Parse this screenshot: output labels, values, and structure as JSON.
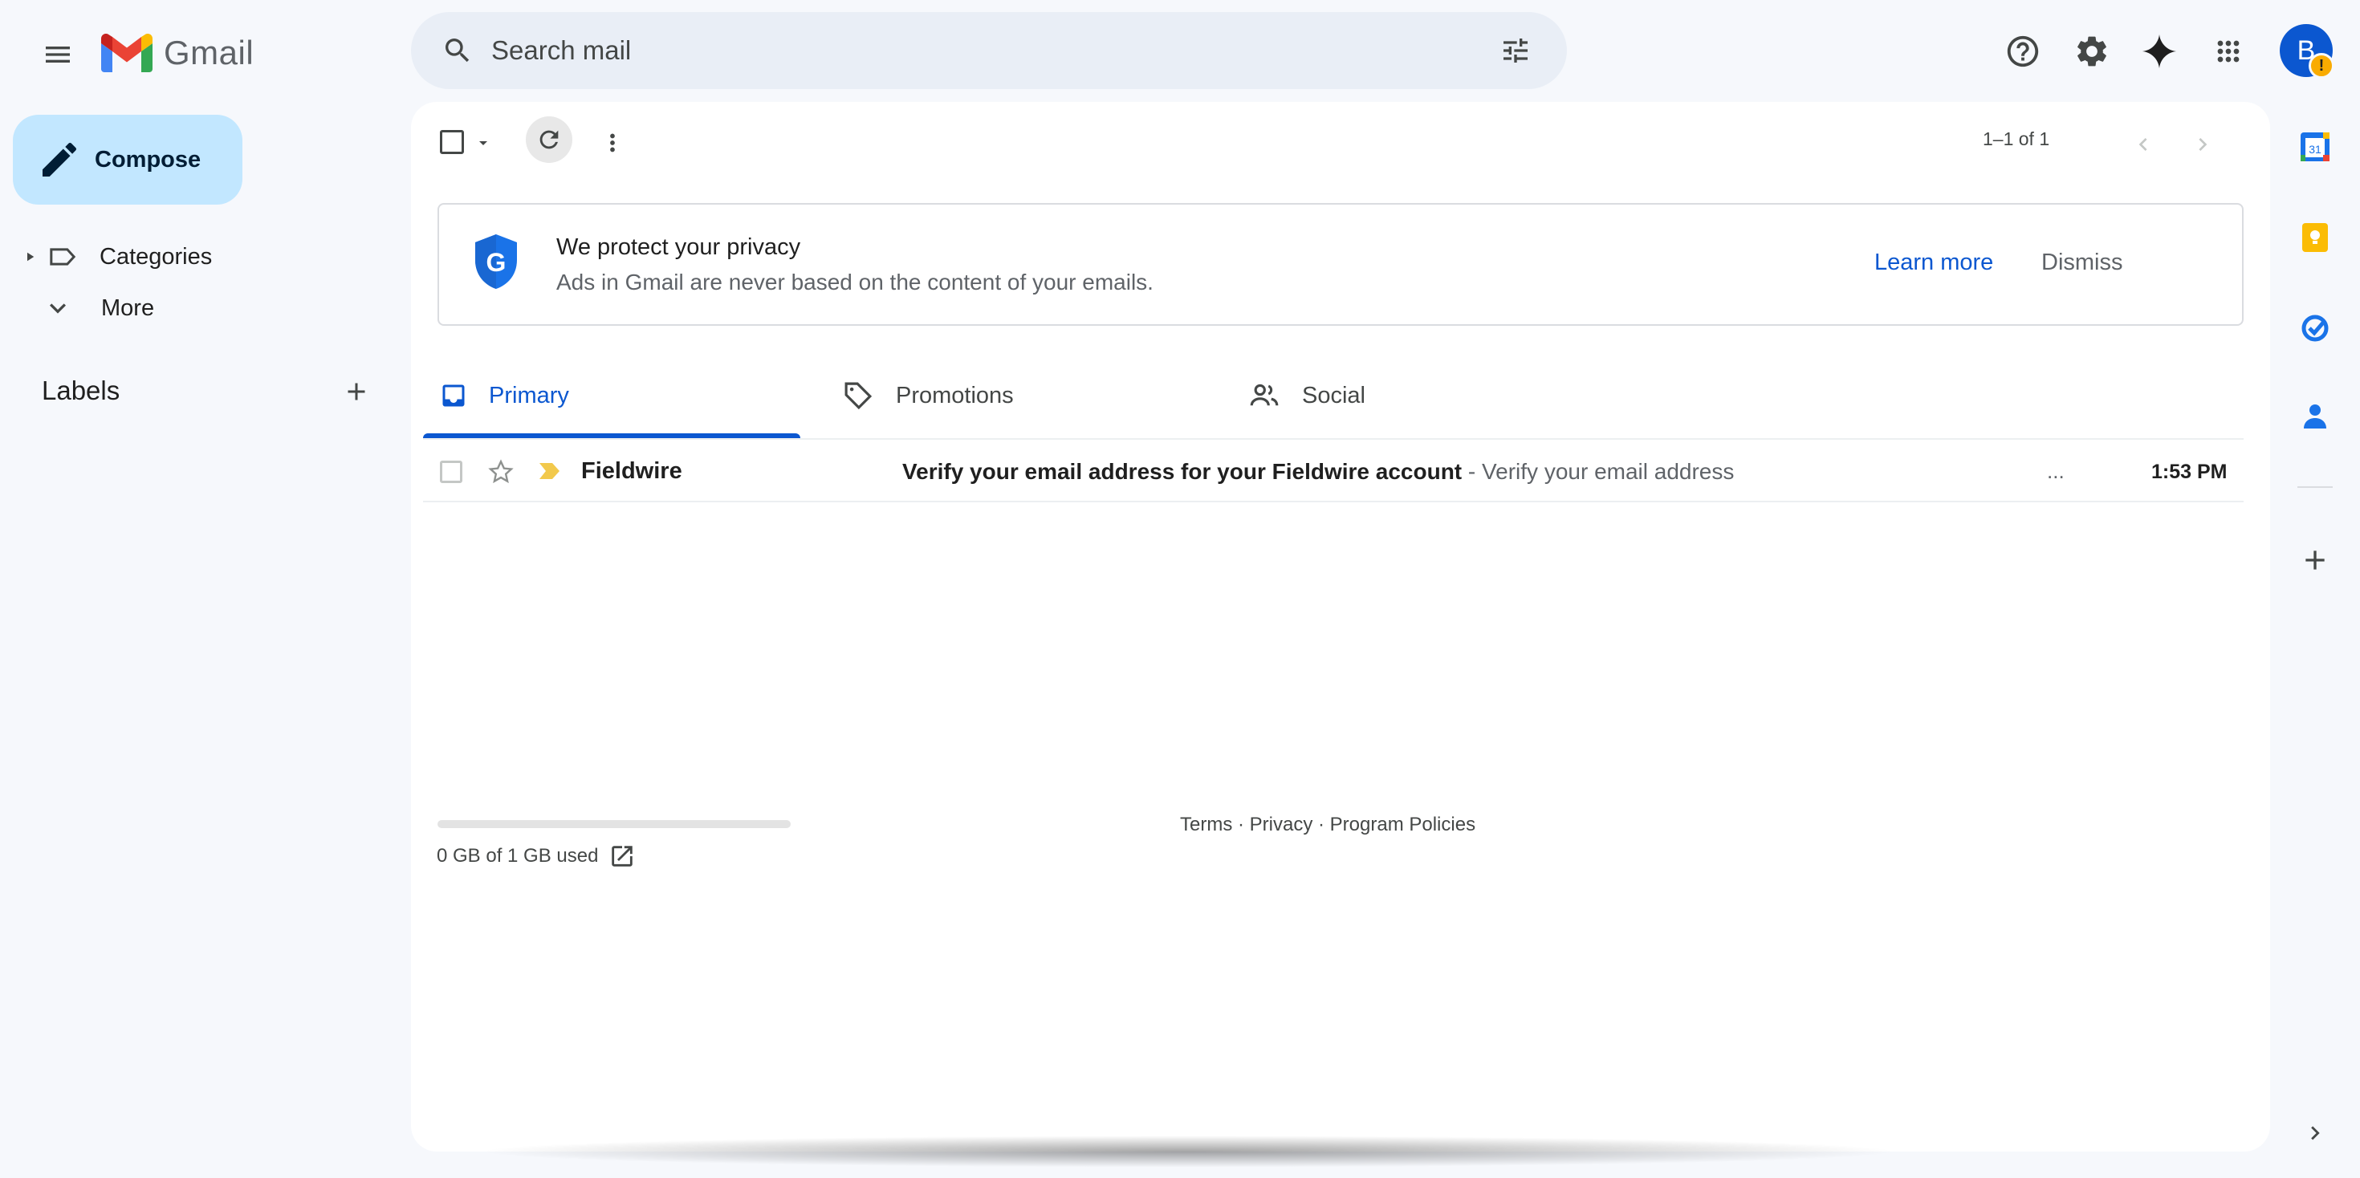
{
  "header": {
    "app_name": "Gmail",
    "search_placeholder": "Search mail",
    "avatar_initial": "B",
    "avatar_warning": "!"
  },
  "sidebar": {
    "compose_label": "Compose",
    "items": [
      {
        "label": "Categories",
        "icon": "label-icon"
      },
      {
        "label": "More",
        "icon": "chevron-down-icon"
      }
    ],
    "labels_heading": "Labels"
  },
  "toolbar": {
    "pager_text": "1–1 of 1"
  },
  "privacy_banner": {
    "title": "We protect your privacy",
    "subtitle": "Ads in Gmail are never based on the content of your emails.",
    "learn_more": "Learn more",
    "dismiss": "Dismiss",
    "shield_letter": "G"
  },
  "tabs": [
    {
      "label": "Primary",
      "icon": "inbox-icon",
      "active": true
    },
    {
      "label": "Promotions",
      "icon": "tag-icon",
      "active": false
    },
    {
      "label": "Social",
      "icon": "people-icon",
      "active": false
    }
  ],
  "emails": [
    {
      "sender": "Fieldwire",
      "subject": "Verify your email address for your Fieldwire account",
      "snippet": " - Verify your email address",
      "ellipsis": "...",
      "time": "1:53 PM",
      "unread": true,
      "important": true
    }
  ],
  "footer": {
    "storage_text": "0 GB of 1 GB used",
    "links": "Terms · Privacy · Program Policies"
  },
  "side_panel": {
    "calendar_day": "31"
  },
  "colors": {
    "accent": "#0b57d0",
    "compose_bg": "#c2e7ff",
    "background": "#f6f8fc",
    "important_marker": "#f2c94c"
  }
}
